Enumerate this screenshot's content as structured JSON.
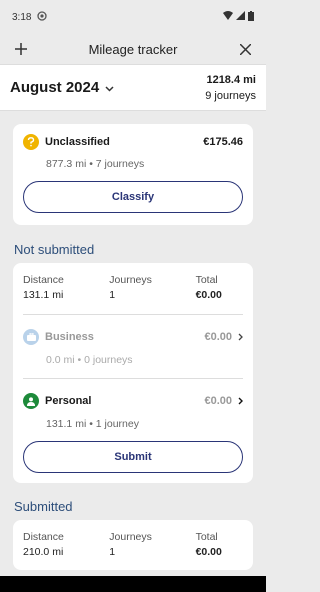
{
  "status_bar": {
    "time": "3:18"
  },
  "app_bar": {
    "title": "Mileage tracker"
  },
  "month_bar": {
    "month": "August 2024",
    "total_distance": "1218.4 mi",
    "total_journeys": "9 journeys"
  },
  "unclassified": {
    "title": "Unclassified",
    "amount": "€175.46",
    "details": "877.3 mi • 7 journeys",
    "button": "Classify"
  },
  "not_submitted": {
    "section_title": "Not submitted",
    "stats": {
      "distance_label": "Distance",
      "distance_value": "131.1 mi",
      "journeys_label": "Journeys",
      "journeys_value": "1",
      "total_label": "Total",
      "total_value": "€0.00"
    },
    "business": {
      "title": "Business",
      "amount": "€0.00",
      "details": "0.0 mi • 0 journeys"
    },
    "personal": {
      "title": "Personal",
      "amount": "€0.00",
      "details": "131.1 mi • 1 journey"
    },
    "button": "Submit"
  },
  "submitted": {
    "section_title": "Submitted",
    "stats": {
      "distance_label": "Distance",
      "distance_value": "210.0 mi",
      "journeys_label": "Journeys",
      "journeys_value": "1",
      "total_label": "Total",
      "total_value": "€0.00"
    }
  }
}
